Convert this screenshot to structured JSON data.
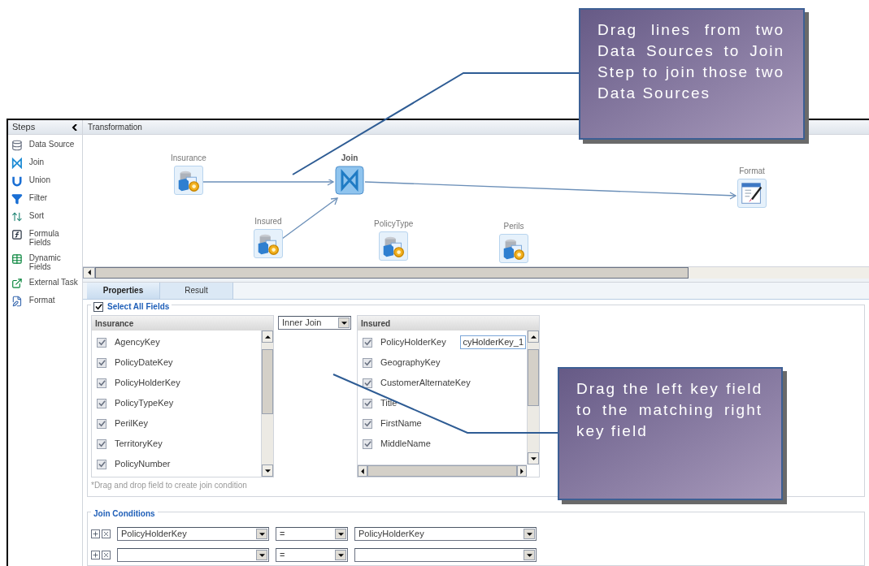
{
  "steps": {
    "title": "Steps",
    "items": [
      {
        "label": "Data Source",
        "kind": "datasource"
      },
      {
        "label": "Join",
        "kind": "join"
      },
      {
        "label": "Union",
        "kind": "union"
      },
      {
        "label": "Filter",
        "kind": "filter"
      },
      {
        "label": "Sort",
        "kind": "sort"
      },
      {
        "label": "Formula Fields",
        "kind": "formula"
      },
      {
        "label": "Dynamic Fields",
        "kind": "dynamic"
      },
      {
        "label": "External Task",
        "kind": "external"
      },
      {
        "label": "Format",
        "kind": "format"
      }
    ]
  },
  "canvas": {
    "title": "Transformation",
    "nodes": [
      {
        "label": "Insurance",
        "kind": "source"
      },
      {
        "label": "Join",
        "kind": "join"
      },
      {
        "label": "Insured",
        "kind": "source"
      },
      {
        "label": "PolicyType",
        "kind": "source"
      },
      {
        "label": "Perils",
        "kind": "source"
      },
      {
        "label": "Format",
        "kind": "format"
      }
    ]
  },
  "tabs": [
    {
      "label": "Properties",
      "selected": true
    },
    {
      "label": "Result",
      "selected": false
    }
  ],
  "select_all": {
    "label": "Select All Fields",
    "checked": true
  },
  "left_table": {
    "title": "Insurance",
    "fields": [
      {
        "name": "AgencyKey",
        "checked": true
      },
      {
        "name": "PolicyDateKey",
        "checked": true
      },
      {
        "name": "PolicyHolderKey",
        "checked": true
      },
      {
        "name": "PolicyTypeKey",
        "checked": true
      },
      {
        "name": "PerilKey",
        "checked": true
      },
      {
        "name": "TerritoryKey",
        "checked": true
      },
      {
        "name": "PolicyNumber",
        "checked": true
      }
    ]
  },
  "join_type": "Inner Join",
  "right_table": {
    "title": "Insured",
    "alias": "cyHolderKey_1",
    "fields": [
      {
        "name": "PolicyHolderKey",
        "checked": true
      },
      {
        "name": "GeographyKey",
        "checked": true
      },
      {
        "name": "CustomerAlternateKey",
        "checked": true
      },
      {
        "name": "Title",
        "checked": true
      },
      {
        "name": "FirstName",
        "checked": true
      },
      {
        "name": "MiddleName",
        "checked": true
      }
    ]
  },
  "hint": "*Drag and drop field to create join condition",
  "join_conditions": {
    "title": "Join Conditions",
    "rows": [
      {
        "left": "PolicyHolderKey",
        "operator": "=",
        "right": "PolicyHolderKey"
      },
      {
        "operator": "="
      }
    ]
  },
  "callouts": [
    {
      "text": "Drag lines from two Data Sources to Join Step to join those two Data Sources"
    },
    {
      "text": "Drag the left key field to the matching right key field"
    }
  ]
}
